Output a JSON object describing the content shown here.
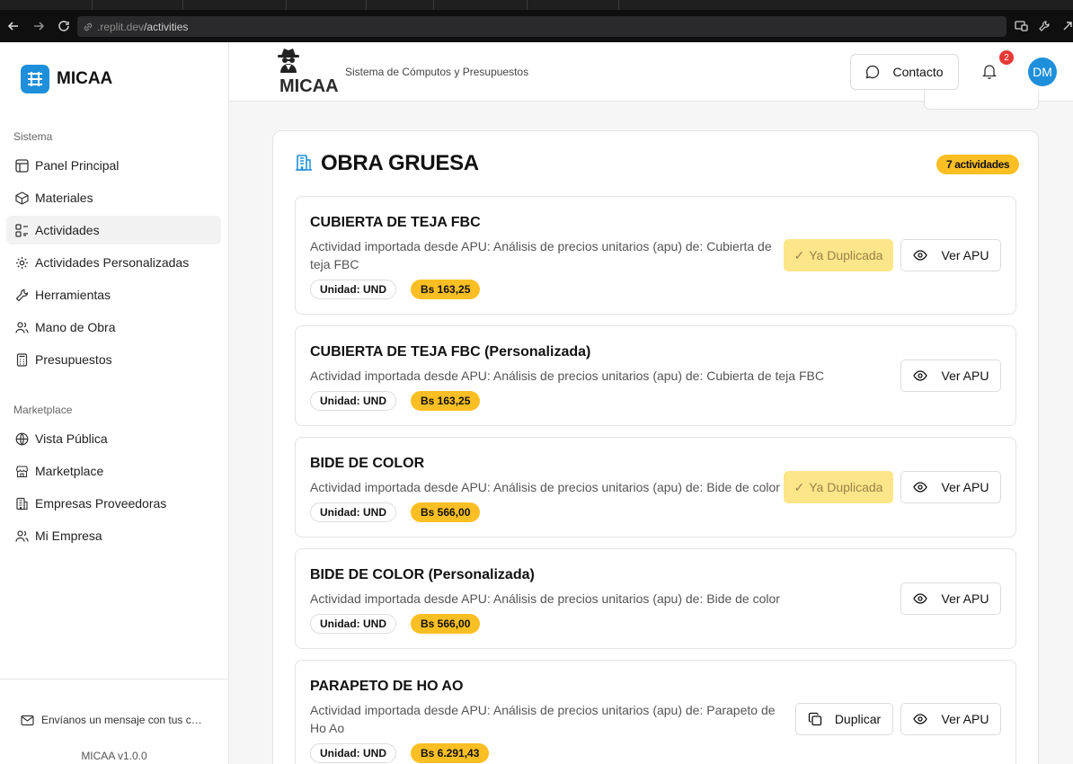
{
  "browser": {
    "url_prefix": ".replit.dev",
    "url_path": "/activities"
  },
  "sidebar": {
    "brand": "MICAA",
    "section_sistema": "Sistema",
    "items_sistema": [
      {
        "label": "Panel Principal",
        "icon": "layout-icon"
      },
      {
        "label": "Materiales",
        "icon": "box-icon"
      },
      {
        "label": "Actividades",
        "icon": "activities-icon",
        "active": true
      },
      {
        "label": "Actividades Personalizadas",
        "icon": "gear-icon"
      },
      {
        "label": "Herramientas",
        "icon": "wrench-icon"
      },
      {
        "label": "Mano de Obra",
        "icon": "users-icon"
      },
      {
        "label": "Presupuestos",
        "icon": "calculator-icon"
      }
    ],
    "section_marketplace": "Marketplace",
    "items_marketplace": [
      {
        "label": "Vista Pública",
        "icon": "globe-icon"
      },
      {
        "label": "Marketplace",
        "icon": "store-icon"
      },
      {
        "label": "Empresas Proveedoras",
        "icon": "building-icon"
      },
      {
        "label": "Mi Empresa",
        "icon": "users-icon"
      }
    ],
    "message_link": "Envíanos un mensaje con tus c…",
    "version": "MICAA v1.0.0"
  },
  "header": {
    "title": "MICAA",
    "subtitle": "Sistema de Cómputos y Presupuestos",
    "contact_label": "Contacto",
    "notifications_count": "2",
    "avatar_initials": "DM"
  },
  "section": {
    "title": "OBRA GRUESA",
    "count_label": "7 actividades",
    "accent": "#1e8fdb"
  },
  "activities": [
    {
      "title": "CUBIERTA DE TEJA FBC",
      "description": "Actividad importada desde APU: Análisis de precios unitarios (apu) de: Cubierta de teja FBC",
      "unit": "Unidad: UND",
      "price": "Bs 163,25",
      "action": "Ya Duplicada",
      "view_label": "Ver APU"
    },
    {
      "title": "CUBIERTA DE TEJA FBC (Personalizada)",
      "description": "Actividad importada desde APU: Análisis de precios unitarios (apu) de: Cubierta de teja FBC",
      "unit": "Unidad: UND",
      "price": "Bs 163,25",
      "action": "",
      "view_label": "Ver APU"
    },
    {
      "title": "BIDE DE COLOR",
      "description": "Actividad importada desde APU: Análisis de precios unitarios (apu) de: Bide de color",
      "unit": "Unidad: UND",
      "price": "Bs 566,00",
      "action": "Ya Duplicada",
      "view_label": "Ver APU"
    },
    {
      "title": "BIDE DE COLOR (Personalizada)",
      "description": "Actividad importada desde APU: Análisis de precios unitarios (apu) de: Bide de color",
      "unit": "Unidad: UND",
      "price": "Bs 566,00",
      "action": "",
      "view_label": "Ver APU"
    },
    {
      "title": "PARAPETO DE HO AO",
      "description": "Actividad importada desde APU: Análisis de precios unitarios (apu) de: Parapeto de Ho Ao",
      "unit": "Unidad: UND",
      "price": "Bs 6.291,43",
      "action": "Duplicar",
      "view_label": "Ver APU"
    }
  ],
  "colors": {
    "primary": "#1e8fdb",
    "price_badge": "#fbbf24",
    "duplicated_bg": "#fde68a",
    "notification": "#e53935"
  }
}
